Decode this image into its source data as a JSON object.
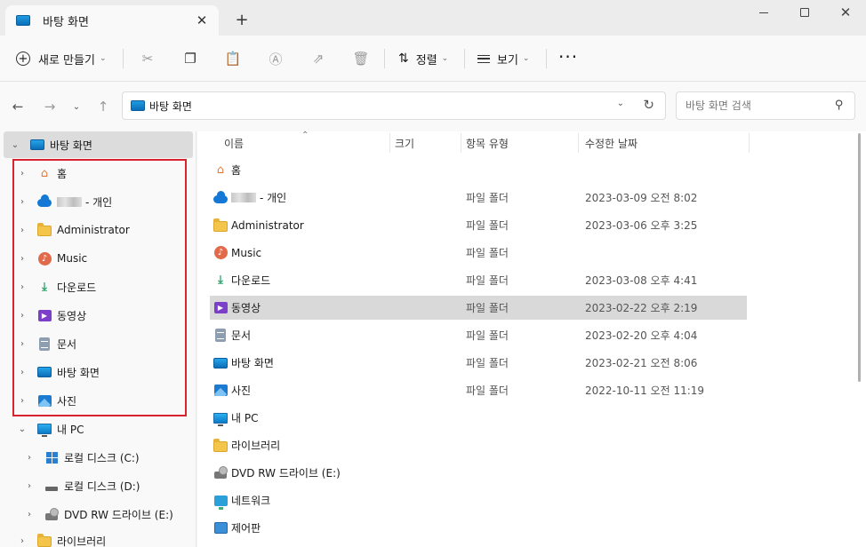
{
  "window": {
    "tab_title": "바탕 화면",
    "close_tab": "✕",
    "new_tab": "+",
    "minimize": "",
    "maximize": "",
    "close": "✕"
  },
  "toolbar": {
    "new_label": "새로 만들기",
    "sort_label": "정렬",
    "view_label": "보기",
    "more_label": "···",
    "icons": [
      "cut-icon",
      "copy-icon",
      "paste-icon",
      "rename-icon",
      "share-icon",
      "delete-icon"
    ]
  },
  "address": {
    "path": "바탕 화면",
    "search_placeholder": "바탕 화면 검색"
  },
  "nav_tree": {
    "root": "바탕 화면",
    "items": [
      {
        "label": "홈",
        "icon": "home-icon"
      },
      {
        "label": "- 개인",
        "icon": "onedrive-icon",
        "blurred": true
      },
      {
        "label": "Administrator",
        "icon": "folder-icon"
      },
      {
        "label": "Music",
        "icon": "music-icon"
      },
      {
        "label": "다운로드",
        "icon": "download-icon"
      },
      {
        "label": "동영상",
        "icon": "video-icon"
      },
      {
        "label": "문서",
        "icon": "document-icon"
      },
      {
        "label": "바탕 화면",
        "icon": "desktop-icon"
      },
      {
        "label": "사진",
        "icon": "pictures-icon"
      }
    ],
    "pc": "내 PC",
    "drives": [
      {
        "label": "로컬 디스크 (C:)",
        "icon": "windows-drive-icon"
      },
      {
        "label": "로컬 디스크 (D:)",
        "icon": "drive-icon"
      },
      {
        "label": "DVD RW 드라이브 (E:)",
        "icon": "dvd-icon"
      }
    ],
    "library": "라이브러리"
  },
  "columns": {
    "name": "이름",
    "size": "크기",
    "type": "항목 유형",
    "modified": "수정한 날짜"
  },
  "files": [
    {
      "name": "홈",
      "type": "",
      "date": "",
      "icon": "home-icon"
    },
    {
      "name": "- 개인",
      "type": "파일 폴더",
      "date": "2023-03-09 오전 8:02",
      "icon": "onedrive-icon",
      "blurred": true
    },
    {
      "name": "Administrator",
      "type": "파일 폴더",
      "date": "2023-03-06 오후 3:25",
      "icon": "folder-icon"
    },
    {
      "name": "Music",
      "type": "파일 폴더",
      "date": "",
      "icon": "music-icon"
    },
    {
      "name": "다운로드",
      "type": "파일 폴더",
      "date": "2023-03-08 오후 4:41",
      "icon": "download-icon"
    },
    {
      "name": "동영상",
      "type": "파일 폴더",
      "date": "2023-02-22 오후 2:19",
      "icon": "video-icon",
      "selected": true
    },
    {
      "name": "문서",
      "type": "파일 폴더",
      "date": "2023-02-20 오후 4:04",
      "icon": "document-icon"
    },
    {
      "name": "바탕 화면",
      "type": "파일 폴더",
      "date": "2023-02-21 오전 8:06",
      "icon": "desktop-icon"
    },
    {
      "name": "사진",
      "type": "파일 폴더",
      "date": "2022-10-11 오전 11:19",
      "icon": "pictures-icon"
    },
    {
      "name": "내 PC",
      "type": "",
      "date": "",
      "icon": "pc-icon"
    },
    {
      "name": "라이브러리",
      "type": "",
      "date": "",
      "icon": "folder-icon"
    },
    {
      "name": "DVD RW 드라이브 (E:)",
      "type": "",
      "date": "",
      "icon": "dvd-icon"
    },
    {
      "name": "네트워크",
      "type": "",
      "date": "",
      "icon": "network-icon"
    },
    {
      "name": "제어판",
      "type": "",
      "date": "",
      "icon": "control-panel-icon"
    }
  ],
  "colors": {
    "highlight_border": "#d9232f",
    "selected_row": "#d9d9d9"
  }
}
